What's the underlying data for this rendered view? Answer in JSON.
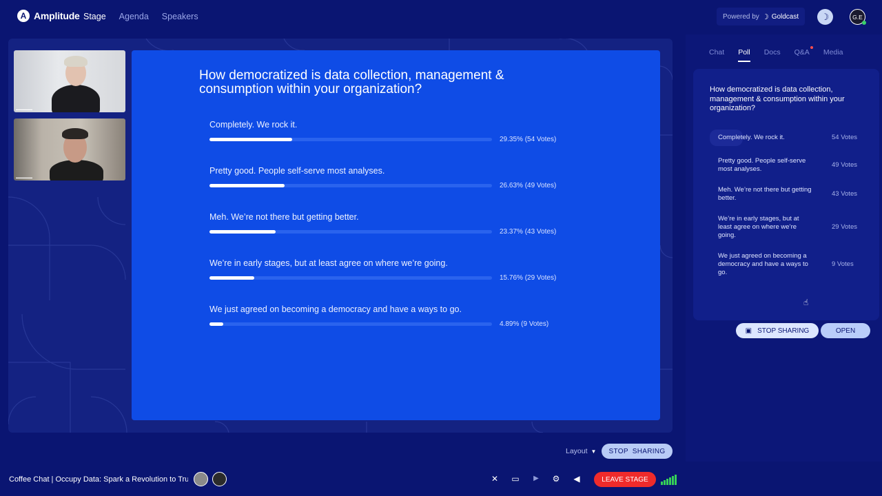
{
  "brand": {
    "logo_glyph": "A",
    "name": "Amplitude"
  },
  "nav": {
    "items": [
      "Stage",
      "Agenda",
      "Speakers"
    ],
    "active_index": 0
  },
  "powered": {
    "prefix": "Powered by",
    "name": "Goldcast"
  },
  "user": {
    "initials": "G.E"
  },
  "poll": {
    "question": "How democratized is data collection, management & consumption within your organization?",
    "options": [
      {
        "label": "Completely. We rock it.",
        "percent_text": "29.35% (54 Votes)",
        "fraction": 0.2935,
        "votes_text": "54 Votes"
      },
      {
        "label": "Pretty good. People self-serve most analyses.",
        "percent_text": "26.63% (49 Votes)",
        "fraction": 0.2663,
        "votes_text": "49 Votes"
      },
      {
        "label": "Meh. We’re not there but getting better.",
        "percent_text": "23.37% (43 Votes)",
        "fraction": 0.2337,
        "votes_text": "43 Votes"
      },
      {
        "label": "We’re in early stages, but at least agree on where we’re going.",
        "percent_text": "15.76% (29 Votes)",
        "fraction": 0.1576,
        "votes_text": "29 Votes"
      },
      {
        "label": "We just agreed on becoming a democracy and have a ways to go.",
        "percent_text": "4.89% (9 Votes)",
        "fraction": 0.0489,
        "votes_text": "9 Votes"
      }
    ]
  },
  "panel": {
    "tabs": [
      "Chat",
      "Poll",
      "Docs",
      "Q&A",
      "Media"
    ],
    "active_tab": "Poll",
    "stop_sharing_label": "STOP SHARING",
    "open_label": "OPEN"
  },
  "bottom": {
    "layout_label": "Layout",
    "stop_sharing_label": "STOP  SHARING",
    "session_title": "Coffee Chat | Occupy Data: Spark a Revolution to Tru...",
    "leave_label": "LEAVE STAGE"
  },
  "colors": {
    "accent": "#0f4ce6",
    "background": "#0a1572",
    "leave": "#ef2b2b",
    "signal": "#36d158"
  }
}
